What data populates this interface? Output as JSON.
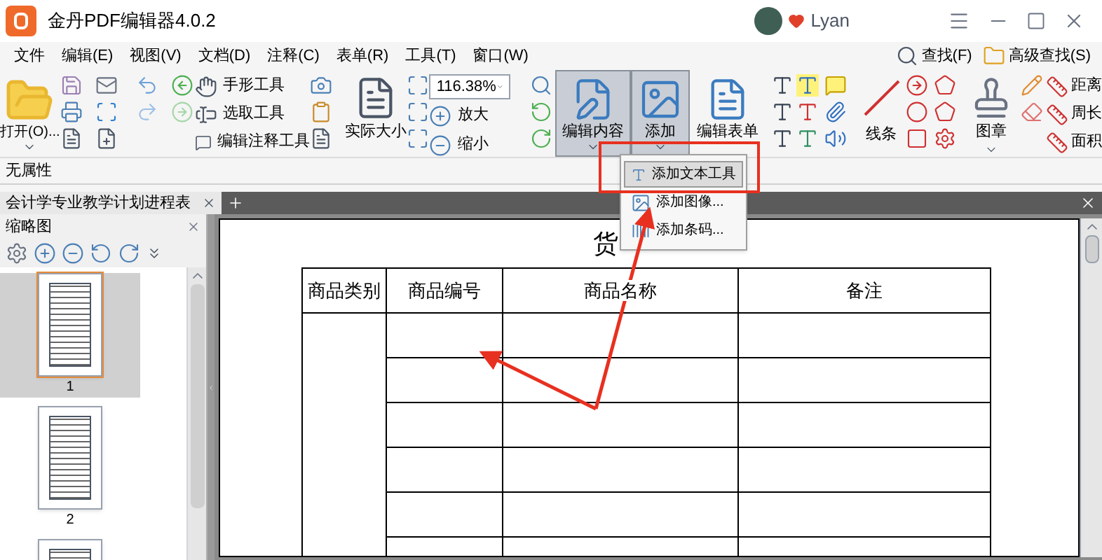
{
  "window": {
    "title": "金丹PDF编辑器4.0.2",
    "user": "Lyan"
  },
  "menu": [
    "文件",
    "编辑(E)",
    "视图(V)",
    "文档(D)",
    "注释(C)",
    "表单(R)",
    "工具(T)",
    "窗口(W)"
  ],
  "search_buttons": [
    "查找(F)",
    "高级查找(S)"
  ],
  "toolbar": {
    "open": "打开(O)...",
    "tools": [
      "手形工具",
      "选取工具",
      "编辑注释工具"
    ],
    "actual_size": "实际大小",
    "zoom": {
      "value": "116.38%"
    },
    "zoom_in": "放大",
    "zoom_out": "缩小",
    "big_buttons": [
      {
        "label": "编辑内容",
        "pressed": true
      },
      {
        "label": "添加",
        "pressed": true
      },
      {
        "label": "编辑表单",
        "pressed": false
      }
    ],
    "line": "线条",
    "stamp": "图章",
    "measure": [
      "距离",
      "周长",
      "面积"
    ]
  },
  "property_bar": "无属性",
  "tabs": [
    {
      "label": "会计学专业教学计划进程表",
      "selected": true
    }
  ],
  "thumbnail_panel": {
    "title": "缩略图",
    "pages": [
      {
        "label": "1",
        "selected": true
      },
      {
        "label": "2",
        "selected": false
      },
      {
        "selected": false
      }
    ]
  },
  "document": {
    "title": "货",
    "columns": [
      "商品类别",
      "商品编号",
      "商品名称",
      "备注"
    ]
  },
  "dropdown": [
    {
      "label": "添加文本工具",
      "selected": true
    },
    {
      "label": "添加图像...",
      "selected": false
    },
    {
      "label": "添加条码...",
      "selected": false
    }
  ]
}
